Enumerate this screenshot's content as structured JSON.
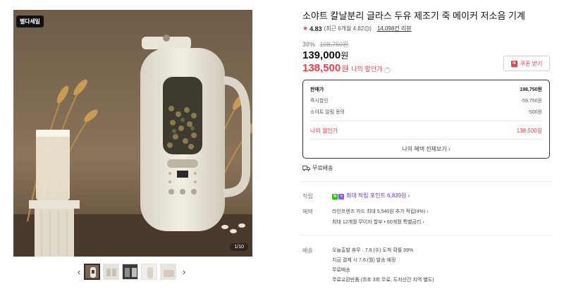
{
  "gallery": {
    "badge": "별다세일",
    "counter": "1/10",
    "prev_arrow": "‹",
    "next_arrow": "›",
    "thumbnail_count": 5
  },
  "product": {
    "title": "소야트 칼날분리 글라스 두유 제조기 죽 메이커 저소음 기계",
    "rating": "4.83",
    "recent_rating": "(최근 6개월 4.82",
    "recent_close": ")",
    "info_icon": "i",
    "reviews": "14,098건 리뷰",
    "discount_pct": "30%",
    "original_price": "108,750원",
    "price": "139,000",
    "price_unit": "원",
    "my_price": "138,500",
    "my_price_unit": "원",
    "my_price_label": "나의 할인가",
    "coupon_button": "쿠폰 받기",
    "coupon_icon_text": "N"
  },
  "breakdown": {
    "sale_label": "판매가",
    "sale_value": "198,750원",
    "instant_label": "즉시할인",
    "instant_value": "-59,750원",
    "alert_label": "소야트 알림 동의",
    "alert_value": "-500원",
    "my_label": "나의 할인가",
    "my_value": "138,500원",
    "all_benefits": "나의 혜택 전체보기 ›"
  },
  "shipping_free": "무료배송",
  "points": {
    "label": "적립",
    "npay": "N",
    "plus": "+",
    "text": "최대 적립 포인트 6,839원 ›"
  },
  "benefits": {
    "label": "혜택",
    "line1": "라인프렌즈 카드 최대 5,540원 추가 적립(4%) ›",
    "line2": "최대 12개월 무이자 할부 • 60개월 특별금리 ›"
  },
  "delivery": {
    "label": "배송",
    "line1": "오늘출발 휴무 · 7.8.(수) 도착 확률 99%",
    "line2": "지금 결제 시 7.6.(월) 발송 예정",
    "line3": "무료배송",
    "line4": "무료교환반품 (최초 3회 무료, 도서산간 지역 별도)"
  },
  "colors": {
    "accent_red": "#f1404b",
    "naver_green": "#1ec800",
    "points_purple": "#5a3cd6"
  }
}
